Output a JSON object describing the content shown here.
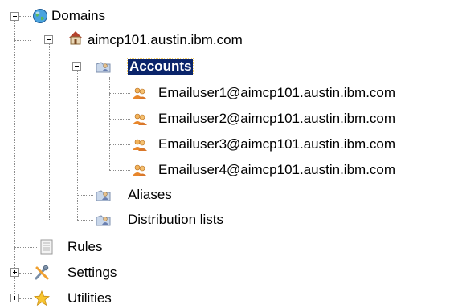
{
  "tree": {
    "domains": {
      "label": "Domains",
      "icon": "globe-icon",
      "host": {
        "label": "aimcp101.austin.ibm.com",
        "icon": "house-icon",
        "accounts": {
          "label": "Accounts",
          "icon": "folder-people-icon",
          "selected": true,
          "users": [
            "Emailuser1@aimcp101.austin.ibm.com",
            "Emailuser2@aimcp101.austin.ibm.com",
            "Emailuser3@aimcp101.austin.ibm.com",
            "Emailuser4@aimcp101.austin.ibm.com"
          ]
        },
        "aliases": {
          "label": "Aliases",
          "icon": "folder-people-icon"
        },
        "distribution_lists": {
          "label": "Distribution lists",
          "icon": "folder-people-icon"
        }
      }
    },
    "rules": {
      "label": "Rules",
      "icon": "document-icon"
    },
    "settings": {
      "label": "Settings",
      "icon": "tools-icon"
    },
    "utilities": {
      "label": "Utilities",
      "icon": "star-icon"
    }
  },
  "colors": {
    "selection": "#0a246a",
    "guide_lines": "#8c8c8c"
  }
}
